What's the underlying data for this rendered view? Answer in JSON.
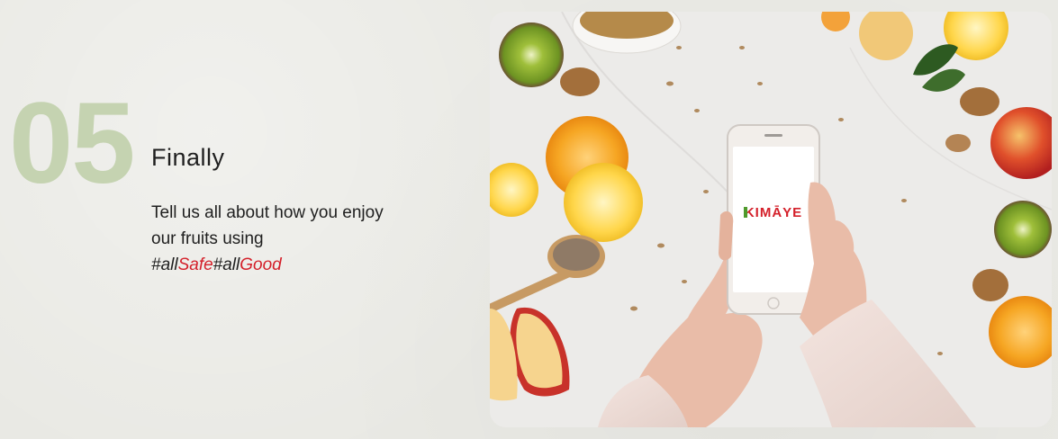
{
  "step": {
    "number": "05",
    "title": "Finally",
    "body_line1": "Tell us all about how you enjoy",
    "body_line2": "our fruits using",
    "hashtag": {
      "part1": "#all",
      "part2": "Safe",
      "part3": "#all",
      "part4": "Good"
    }
  },
  "photo": {
    "phone_logo": "KIMĀYE"
  },
  "colors": {
    "number": "#c5d3b1",
    "accent": "#d4202a",
    "text": "#1f1f1f",
    "background": "#e9e9e4"
  }
}
